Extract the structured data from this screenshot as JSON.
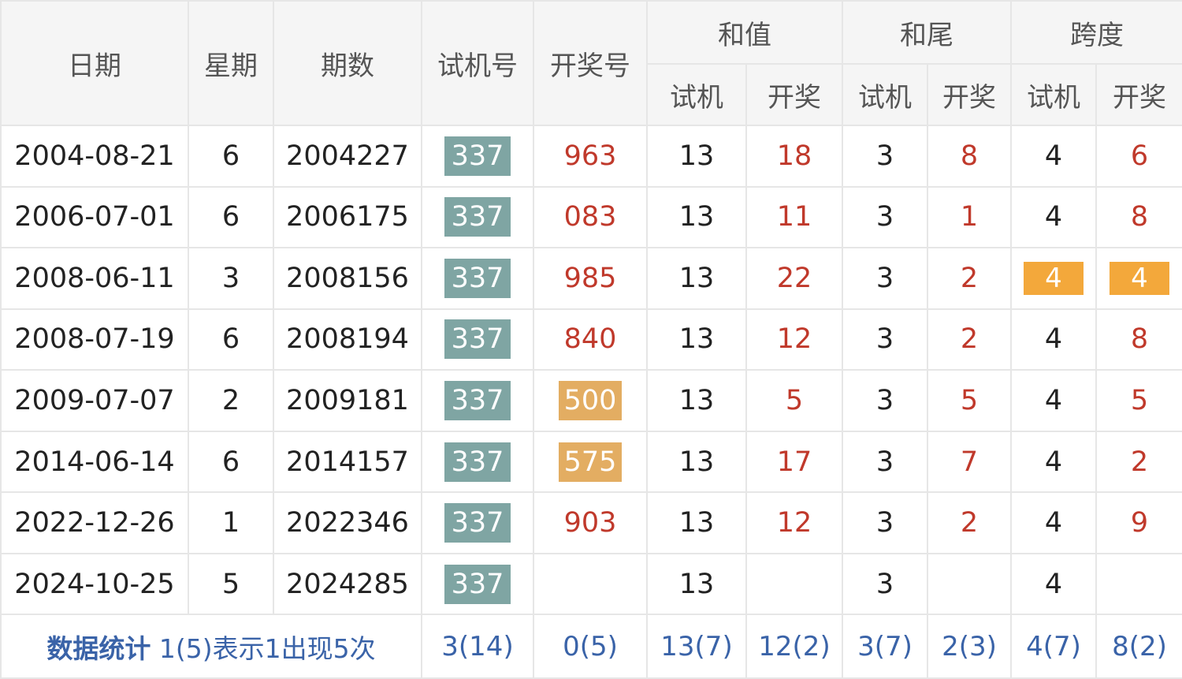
{
  "header": {
    "date": "日期",
    "weekday": "星期",
    "issue": "期数",
    "trial_no": "试机号",
    "draw_no": "开奖号",
    "sum": "和值",
    "sum_tail": "和尾",
    "span": "跨度",
    "trial": "试机",
    "draw": "开奖"
  },
  "rows": [
    {
      "date": "2004-08-21",
      "weekday": "6",
      "issue": "2004227",
      "trial": "337",
      "draw": "963",
      "sum_trial": "13",
      "sum_draw": "18",
      "tail_trial": "3",
      "tail_draw": "8",
      "span_trial": "4",
      "span_draw": "6"
    },
    {
      "date": "2006-07-01",
      "weekday": "6",
      "issue": "2006175",
      "trial": "337",
      "draw": "083",
      "sum_trial": "13",
      "sum_draw": "11",
      "tail_trial": "3",
      "tail_draw": "1",
      "span_trial": "4",
      "span_draw": "8"
    },
    {
      "date": "2008-06-11",
      "weekday": "3",
      "issue": "2008156",
      "trial": "337",
      "draw": "985",
      "sum_trial": "13",
      "sum_draw": "22",
      "tail_trial": "3",
      "tail_draw": "2",
      "span_trial": "4",
      "span_draw": "4"
    },
    {
      "date": "2008-07-19",
      "weekday": "6",
      "issue": "2008194",
      "trial": "337",
      "draw": "840",
      "sum_trial": "13",
      "sum_draw": "12",
      "tail_trial": "3",
      "tail_draw": "2",
      "span_trial": "4",
      "span_draw": "8"
    },
    {
      "date": "2009-07-07",
      "weekday": "2",
      "issue": "2009181",
      "trial": "337",
      "draw": "500",
      "sum_trial": "13",
      "sum_draw": "5",
      "tail_trial": "3",
      "tail_draw": "5",
      "span_trial": "4",
      "span_draw": "5"
    },
    {
      "date": "2014-06-14",
      "weekday": "6",
      "issue": "2014157",
      "trial": "337",
      "draw": "575",
      "sum_trial": "13",
      "sum_draw": "17",
      "tail_trial": "3",
      "tail_draw": "7",
      "span_trial": "4",
      "span_draw": "2"
    },
    {
      "date": "2022-12-26",
      "weekday": "1",
      "issue": "2022346",
      "trial": "337",
      "draw": "903",
      "sum_trial": "13",
      "sum_draw": "12",
      "tail_trial": "3",
      "tail_draw": "2",
      "span_trial": "4",
      "span_draw": "9"
    },
    {
      "date": "2024-10-25",
      "weekday": "5",
      "issue": "2024285",
      "trial": "337",
      "draw": "",
      "sum_trial": "13",
      "sum_draw": "",
      "tail_trial": "3",
      "tail_draw": "",
      "span_trial": "4",
      "span_draw": ""
    }
  ],
  "stats": {
    "label": "数据统计",
    "description": "1(5)表示1出现5次",
    "trial_no": "3(14)",
    "draw_no": "0(5)",
    "sum_trial": "13(7)",
    "sum_draw": "12(2)",
    "tail_trial": "3(7)",
    "tail_draw": "2(3)",
    "span_trial": "4(7)",
    "span_draw": "8(2)"
  },
  "colors": {
    "trial_box": "#7fa5a3",
    "draw_highlight": "#e3ad62",
    "span_highlight": "#f3a83b",
    "draw_text": "#c0392b",
    "stat_text": "#3a63a8",
    "header_bg": "#f5f5f5"
  }
}
